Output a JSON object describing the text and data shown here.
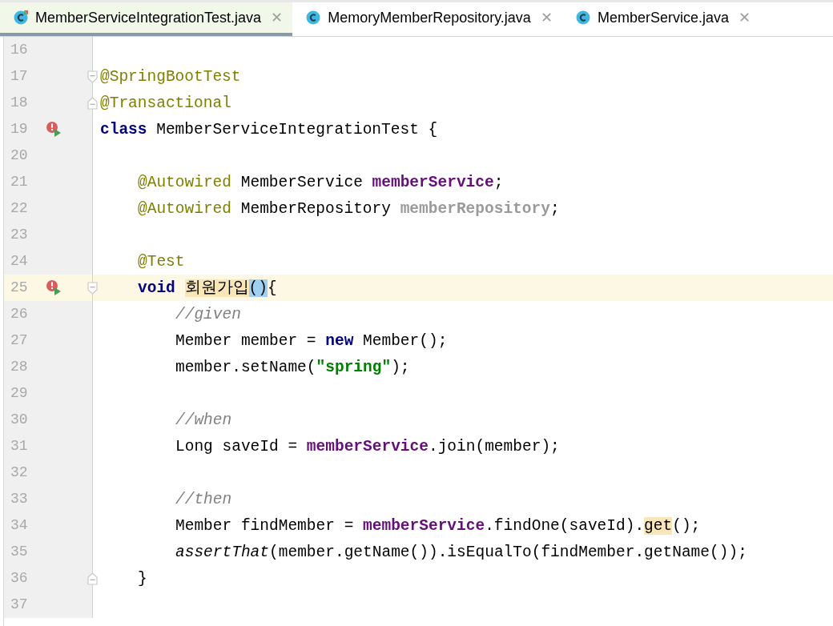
{
  "tabs": [
    {
      "label": "MemberServiceIntegrationTest.java",
      "selected": true,
      "kind": "test",
      "close": "✕"
    },
    {
      "label": "MemoryMemberRepository.java",
      "selected": false,
      "kind": "class",
      "close": "✕"
    },
    {
      "label": "MemberService.java",
      "selected": false,
      "kind": "class",
      "close": "✕"
    }
  ],
  "lines": [
    {
      "number": "16"
    },
    {
      "number": "17",
      "fold_start": true,
      "tokens": [
        {
          "text": "@SpringBootTest",
          "kind": "annotation"
        }
      ]
    },
    {
      "number": "18",
      "fold_end": true,
      "tokens": [
        {
          "text": "@Transactional",
          "kind": "annotation"
        }
      ]
    },
    {
      "number": "19",
      "run_marker": true,
      "tokens": [
        {
          "text": "class",
          "kind": "keyword"
        },
        {
          "text": " MemberServiceIntegrationTest {",
          "kind": "plain"
        }
      ],
      "children": [
        {
          "number": "20"
        },
        {
          "number": "21",
          "tokens": [
            {
              "text": "@Autowired",
              "kind": "annotation"
            },
            {
              "text": " MemberService ",
              "kind": "plain"
            },
            {
              "text": "memberService",
              "kind": "field"
            },
            {
              "text": ";",
              "kind": "plain"
            }
          ]
        },
        {
          "number": "22",
          "tokens": [
            {
              "text": "@Autowired",
              "kind": "annotation"
            },
            {
              "text": " MemberRepository ",
              "kind": "plain"
            },
            {
              "text": "memberRepository",
              "kind": "unused"
            },
            {
              "text": ";",
              "kind": "plain"
            }
          ]
        },
        {
          "number": "23"
        },
        {
          "number": "24",
          "tokens": [
            {
              "text": "@Test",
              "kind": "annotation"
            }
          ]
        },
        {
          "number": "25",
          "run_marker": true,
          "fold_start": true,
          "current": true,
          "tokens": [
            {
              "text": "void ",
              "kind": "keyword"
            },
            {
              "text": "회원가입",
              "kind": "highlight"
            },
            {
              "text": "()",
              "kind": "brace"
            },
            {
              "text": "{",
              "kind": "plain"
            }
          ],
          "children": [
            {
              "number": "26",
              "tokens": [
                {
                  "text": "//given",
                  "kind": "comment"
                }
              ]
            },
            {
              "number": "27",
              "tokens": [
                {
                  "text": "Member member = ",
                  "kind": "plain"
                },
                {
                  "text": "new",
                  "kind": "keyword"
                },
                {
                  "text": " Member();",
                  "kind": "plain"
                }
              ]
            },
            {
              "number": "28",
              "tokens": [
                {
                  "text": "member.setName(",
                  "kind": "plain"
                },
                {
                  "text": "\"spring\"",
                  "kind": "string"
                },
                {
                  "text": ");",
                  "kind": "plain"
                }
              ]
            },
            {
              "number": "29"
            },
            {
              "number": "30",
              "tokens": [
                {
                  "text": "//when",
                  "kind": "comment"
                }
              ]
            },
            {
              "number": "31",
              "tokens": [
                {
                  "text": "Long saveId = ",
                  "kind": "plain"
                },
                {
                  "text": "memberService",
                  "kind": "field"
                },
                {
                  "text": ".join(member);",
                  "kind": "plain"
                }
              ]
            },
            {
              "number": "32"
            },
            {
              "number": "33",
              "tokens": [
                {
                  "text": "//then",
                  "kind": "comment"
                }
              ]
            },
            {
              "number": "34",
              "tokens": [
                {
                  "text": "Member findMember = ",
                  "kind": "plain"
                },
                {
                  "text": "memberService",
                  "kind": "field"
                },
                {
                  "text": ".findOne(saveId).",
                  "kind": "plain"
                },
                {
                  "text": "get",
                  "kind": "highlight"
                },
                {
                  "text": "();",
                  "kind": "plain"
                }
              ]
            },
            {
              "number": "35",
              "tokens": [
                {
                  "text": "assertThat",
                  "kind": "static"
                },
                {
                  "text": "(member.getName()).isEqualTo(findMember.getName());",
                  "kind": "plain"
                }
              ]
            }
          ]
        },
        {
          "number": "36",
          "fold_end": true,
          "tokens": [
            {
              "text": "}",
              "kind": "plain"
            }
          ]
        }
      ]
    },
    {
      "number": "37"
    }
  ]
}
